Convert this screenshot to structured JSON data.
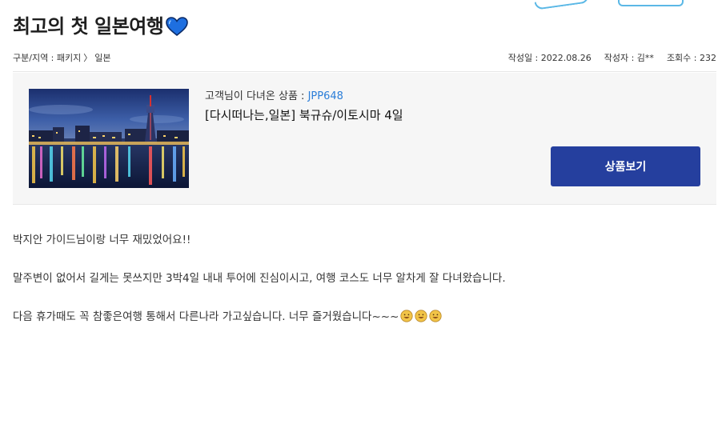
{
  "post": {
    "title": "최고의 첫 일본여행",
    "title_icon": "blue-heart-icon"
  },
  "meta": {
    "category_label": "구분/지역 : 패키지",
    "region": "일본",
    "date": "작성일 : 2022.08.26",
    "author": "작성자 : 김**",
    "views": "조회수 : 232"
  },
  "product": {
    "label_prefix": "고객님이 다녀온 상품 : ",
    "code": "JPP648",
    "name": "[다시떠나는,일본] 북규슈/이토시마 4일",
    "button_label": "상품보기",
    "image_icon": "fukuoka-tower-night-photo"
  },
  "content": {
    "paragraphs": [
      "박지안 가이드님이랑 너무 재밌었어요!!",
      "말주변이 없어서 길게는 못쓰지만 3박4일 내내 투어에 진심이시고, 여행 코스도 너무 알차게 잘 다녀왔습니다.",
      "다음 휴가때도 꼭 참좋은여행 통해서 다른나라 가고싶습니다. 너무 즐거웠습니다~~~"
    ],
    "emoji_icon": "grinning-face-icon"
  },
  "colors": {
    "accent_button": "#253f9e",
    "code_link": "#2a7dd8",
    "heart": "#1e6fe0"
  }
}
